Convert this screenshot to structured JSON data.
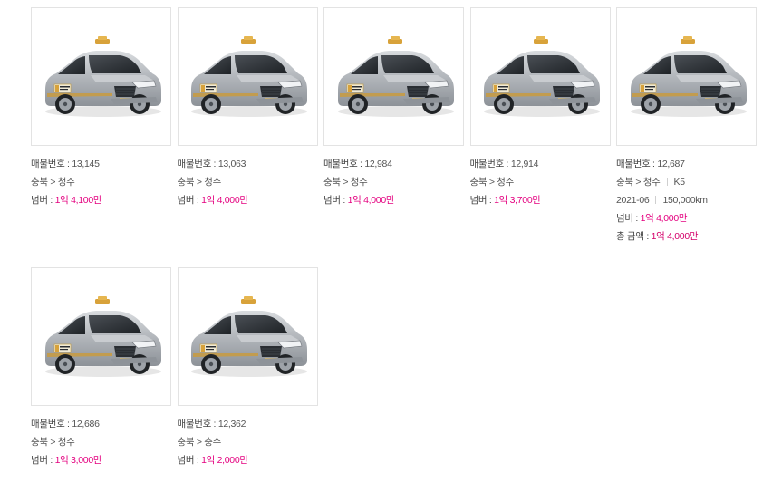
{
  "listings": [
    {
      "no_label": "매물번호 :",
      "no": "13,145",
      "region": "충북 > 청주",
      "price_label": "넘버 :",
      "price": "1억 4,100만"
    },
    {
      "no_label": "매물번호 :",
      "no": "13,063",
      "region": "충북 > 청주",
      "price_label": "넘버 :",
      "price": "1억 4,000만"
    },
    {
      "no_label": "매물번호 :",
      "no": "12,984",
      "region": "충북 > 청주",
      "price_label": "넘버 :",
      "price": "1억 4,000만"
    },
    {
      "no_label": "매물번호 :",
      "no": "12,914",
      "region": "충북 > 청주",
      "price_label": "넘버 :",
      "price": "1억 3,700만"
    },
    {
      "no_label": "매물번호 :",
      "no": "12,687",
      "region": "충북 > 청주",
      "model": "K5",
      "year": "2021-06",
      "mileage": "150,000km",
      "price_label": "넘버 :",
      "price": "1억 4,000만",
      "total_label": "총 금액 :",
      "total": "1억 4,000만"
    },
    {
      "no_label": "매물번호 :",
      "no": "12,686",
      "region": "충북 > 청주",
      "price_label": "넘버 :",
      "price": "1억 3,000만"
    },
    {
      "no_label": "매물번호 :",
      "no": "12,362",
      "region": "충북 > 충주",
      "price_label": "넘버 :",
      "price": "1억 2,000만"
    }
  ],
  "colors": {
    "price": "#e4007f",
    "total": "#d4006a",
    "car_body": "#a9adb3",
    "taxi_sign": "#d8a23a"
  },
  "icons": {
    "thumbnail": "taxi-car-image"
  }
}
